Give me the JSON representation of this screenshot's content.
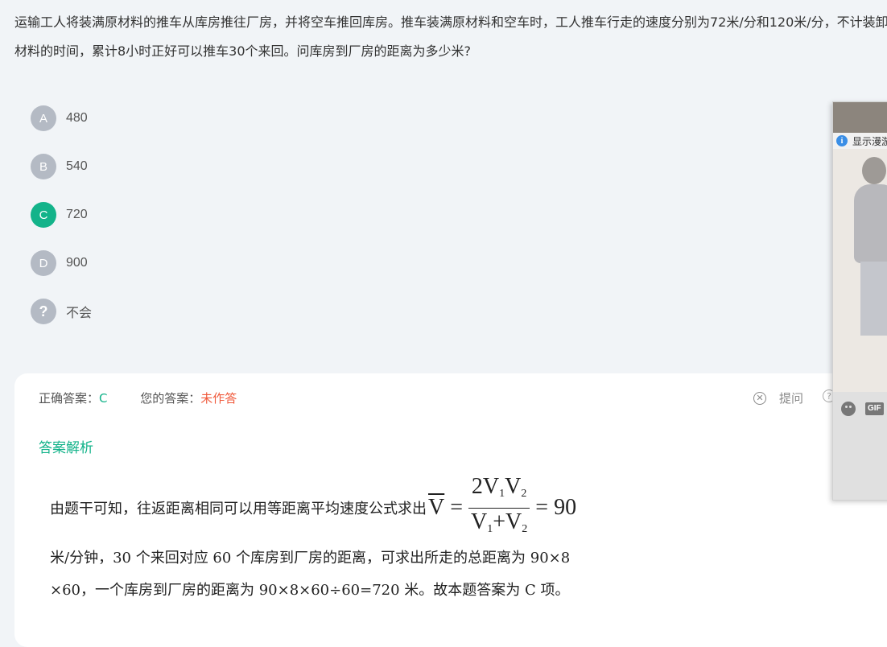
{
  "question": "运输工人将装满原材料的推车从库房推往厂房，并将空车推回库房。推车装满原材料和空车时，工人推车行走的速度分别为72米/分和120米/分，不计装卸材料的时间，累计8小时正好可以推车30个来回。问库房到厂房的距离为多少米?",
  "options": [
    {
      "letter": "A",
      "text": "480"
    },
    {
      "letter": "B",
      "text": "540"
    },
    {
      "letter": "C",
      "text": "720"
    },
    {
      "letter": "D",
      "text": "900"
    }
  ],
  "unknown_option": {
    "icon": "?",
    "text": "不会"
  },
  "answer_panel": {
    "correct_label": "正确答案：",
    "correct_value": "C",
    "user_label": "您的答案：",
    "user_value": "未作答",
    "ask_label": "提问",
    "help_icon": "?",
    "analysis_title": "答案解析",
    "explanation_intro": "由题干可知，往返距离相同可以用等距离平均速度公式求出",
    "formula": {
      "lhs": "V",
      "num_coef": "2",
      "result": "= 90"
    },
    "explanation_line2": "米/分钟，30 个来回对应 60 个库房到厂房的距离，可求出所走的总距离为 90×8",
    "explanation_line3": "×60，一个库房到厂房的距离为 90×8×60÷60=720 米。故本题答案为 C 项。"
  },
  "widget": {
    "banner_text": "显示漫游",
    "info_icon": "i",
    "gif_label": "GIF"
  },
  "colors": {
    "accent": "#13b38a",
    "warning": "#f05a3c",
    "badge": "#b4bac4"
  }
}
